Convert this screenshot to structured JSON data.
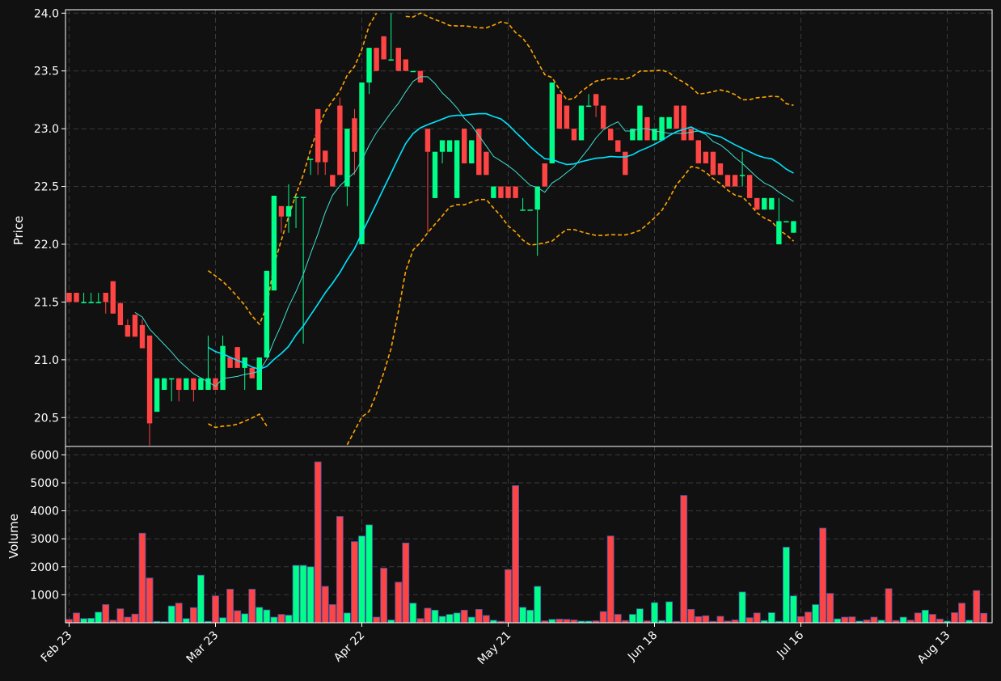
{
  "chart_data": {
    "type": "candlestick",
    "ylabel_price": "Price",
    "ylabel_volume": "Volume",
    "price_ylim": [
      20.25,
      24.03
    ],
    "price_yticks": [
      "20.5",
      "21.0",
      "21.5",
      "22.0",
      "22.5",
      "23.0",
      "23.5",
      "24.0"
    ],
    "volume_ylim": [
      0,
      6300
    ],
    "volume_yticks": [
      "1000",
      "2000",
      "3000",
      "4000",
      "5000",
      "6000"
    ],
    "x_ticks": [
      {
        "label": "Feb 23",
        "index": 0
      },
      {
        "label": "Mar 23",
        "index": 20
      },
      {
        "label": "Apr 22",
        "index": 40
      },
      {
        "label": "May 21",
        "index": 60
      },
      {
        "label": "Jun 18",
        "index": 80
      },
      {
        "label": "Jul 16",
        "index": 100
      },
      {
        "label": "Aug 13",
        "index": 120
      }
    ],
    "grid": true,
    "colors": {
      "background": "#111111",
      "up": "#00ff88",
      "down": "#ff4444",
      "sma_fast": "#40e0d0",
      "sma_slow": "#00e5ff",
      "bands": "#ffa500",
      "volume_edge": "#4455aa"
    },
    "candles": [
      [
        21.58,
        21.58,
        21.5,
        21.5
      ],
      [
        21.58,
        21.58,
        21.5,
        21.5
      ],
      [
        21.5,
        21.58,
        21.5,
        21.5
      ],
      [
        21.5,
        21.58,
        21.5,
        21.5
      ],
      [
        21.5,
        21.58,
        21.5,
        21.5
      ],
      [
        21.58,
        21.58,
        21.4,
        21.5
      ],
      [
        21.68,
        21.68,
        21.4,
        21.4
      ],
      [
        21.49,
        21.5,
        21.3,
        21.3
      ],
      [
        21.3,
        21.35,
        21.2,
        21.2
      ],
      [
        21.39,
        21.39,
        21.2,
        21.2
      ],
      [
        21.3,
        21.35,
        21.1,
        21.1
      ],
      [
        21.21,
        21.21,
        20.26,
        20.45
      ],
      [
        20.55,
        20.84,
        20.55,
        20.84
      ],
      [
        20.74,
        20.84,
        20.74,
        20.84
      ],
      [
        20.84,
        20.84,
        20.64,
        20.84
      ],
      [
        20.84,
        20.84,
        20.64,
        20.74
      ],
      [
        20.74,
        20.84,
        20.74,
        20.84
      ],
      [
        20.84,
        20.84,
        20.64,
        20.74
      ],
      [
        20.74,
        20.84,
        20.74,
        20.84
      ],
      [
        20.74,
        21.21,
        20.74,
        20.84
      ],
      [
        20.84,
        20.84,
        20.74,
        20.74
      ],
      [
        20.74,
        21.21,
        20.74,
        21.12
      ],
      [
        21.02,
        21.02,
        20.93,
        20.93
      ],
      [
        21.11,
        21.11,
        20.93,
        20.93
      ],
      [
        20.93,
        21.02,
        20.74,
        21.02
      ],
      [
        20.93,
        20.93,
        20.84,
        20.84
      ],
      [
        20.74,
        21.02,
        20.74,
        21.02
      ],
      [
        21.02,
        21.77,
        21.02,
        21.77
      ],
      [
        21.6,
        22.42,
        21.6,
        22.42
      ],
      [
        22.33,
        22.33,
        22.1,
        22.24
      ],
      [
        22.24,
        22.52,
        22.1,
        22.33
      ],
      [
        22.41,
        22.41,
        22.14,
        22.41
      ],
      [
        22.41,
        22.41,
        21.14,
        22.41
      ],
      [
        22.74,
        22.74,
        22.6,
        22.74
      ],
      [
        23.17,
        23.17,
        22.6,
        22.71
      ],
      [
        22.81,
        22.81,
        22.6,
        22.71
      ],
      [
        22.6,
        22.6,
        22.5,
        22.5
      ],
      [
        23.2,
        23.27,
        22.6,
        22.6
      ],
      [
        22.5,
        23.0,
        22.33,
        23.0
      ],
      [
        23.09,
        23.17,
        22.6,
        22.8
      ],
      [
        22.0,
        23.4,
        22.0,
        23.4
      ],
      [
        23.4,
        23.7,
        23.3,
        23.7
      ],
      [
        23.7,
        23.7,
        23.5,
        23.5
      ],
      [
        23.8,
        23.8,
        23.6,
        23.6
      ],
      [
        23.6,
        24.0,
        23.6,
        23.6
      ],
      [
        23.7,
        23.7,
        23.5,
        23.5
      ],
      [
        23.6,
        23.6,
        23.5,
        23.5
      ],
      [
        23.5,
        23.5,
        23.5,
        23.5
      ],
      [
        23.5,
        23.5,
        23.4,
        23.4
      ],
      [
        23.0,
        23.0,
        22.1,
        22.8
      ],
      [
        22.4,
        22.8,
        22.4,
        22.8
      ],
      [
        22.8,
        22.9,
        22.7,
        22.9
      ],
      [
        22.8,
        22.9,
        22.8,
        22.9
      ],
      [
        22.4,
        22.9,
        22.4,
        22.9
      ],
      [
        23.0,
        23.0,
        22.7,
        22.7
      ],
      [
        22.7,
        22.9,
        22.7,
        22.9
      ],
      [
        23.0,
        23.0,
        22.6,
        22.6
      ],
      [
        22.8,
        22.8,
        22.6,
        22.6
      ],
      [
        22.4,
        22.5,
        22.4,
        22.5
      ],
      [
        22.5,
        22.5,
        22.4,
        22.4
      ],
      [
        22.5,
        22.5,
        22.4,
        22.4
      ],
      [
        22.5,
        22.5,
        22.4,
        22.4
      ],
      [
        22.3,
        22.4,
        22.3,
        22.3
      ],
      [
        22.3,
        22.3,
        22.3,
        22.3
      ],
      [
        22.3,
        22.5,
        21.9,
        22.5
      ],
      [
        22.7,
        22.7,
        22.5,
        22.5
      ],
      [
        22.7,
        23.4,
        22.7,
        23.4
      ],
      [
        23.3,
        23.3,
        23.0,
        23.0
      ],
      [
        23.2,
        23.2,
        23.0,
        23.0
      ],
      [
        23.0,
        23.0,
        22.9,
        22.9
      ],
      [
        22.9,
        23.2,
        22.9,
        23.2
      ],
      [
        23.2,
        23.3,
        23.2,
        23.2
      ],
      [
        23.3,
        23.3,
        23.1,
        23.2
      ],
      [
        23.2,
        23.2,
        23.0,
        23.0
      ],
      [
        23.0,
        23.0,
        22.9,
        22.9
      ],
      [
        22.9,
        22.9,
        22.8,
        22.8
      ],
      [
        22.8,
        22.8,
        22.6,
        22.6
      ],
      [
        22.9,
        23.0,
        22.9,
        23.0
      ],
      [
        22.9,
        23.2,
        22.9,
        23.2
      ],
      [
        23.1,
        23.1,
        22.9,
        22.9
      ],
      [
        22.9,
        23.0,
        22.9,
        23.0
      ],
      [
        22.9,
        23.1,
        22.9,
        23.1
      ],
      [
        23.0,
        23.1,
        23.0,
        23.1
      ],
      [
        23.2,
        23.2,
        23.0,
        23.0
      ],
      [
        23.2,
        23.2,
        22.9,
        22.9
      ],
      [
        23.0,
        23.0,
        22.9,
        22.9
      ],
      [
        22.9,
        22.9,
        22.7,
        22.7
      ],
      [
        22.8,
        22.8,
        22.7,
        22.7
      ],
      [
        22.8,
        22.8,
        22.6,
        22.6
      ],
      [
        22.7,
        22.7,
        22.6,
        22.6
      ],
      [
        22.6,
        22.6,
        22.5,
        22.5
      ],
      [
        22.6,
        22.6,
        22.5,
        22.5
      ],
      [
        22.6,
        22.8,
        22.5,
        22.6
      ],
      [
        22.6,
        22.6,
        22.4,
        22.4
      ],
      [
        22.4,
        22.4,
        22.3,
        22.3
      ],
      [
        22.3,
        22.4,
        22.3,
        22.4
      ],
      [
        22.3,
        22.4,
        22.3,
        22.4
      ],
      [
        22.0,
        22.4,
        22.0,
        22.2
      ],
      [
        22.2,
        22.2,
        22.2,
        22.2
      ],
      [
        22.1,
        22.2,
        22.1,
        22.2
      ]
    ],
    "volume": [
      120,
      350,
      150,
      160,
      380,
      650,
      90,
      500,
      200,
      310,
      3200,
      1600,
      50,
      40,
      600,
      700,
      150,
      540,
      1700,
      50,
      960,
      180,
      1200,
      430,
      320,
      1200,
      550,
      460,
      200,
      300,
      270,
      2050,
      2050,
      2000,
      5750,
      1300,
      650,
      3800,
      350,
      2900,
      3100,
      3500,
      200,
      1950,
      100,
      1450,
      2850,
      700,
      150,
      520,
      450,
      230,
      300,
      350,
      450,
      200,
      480,
      260,
      90,
      50,
      1900,
      4900,
      550,
      450,
      1300,
      70,
      120,
      130,
      120,
      100,
      60,
      60,
      70,
      400,
      3100,
      300,
      80,
      300,
      500,
      70,
      720,
      80,
      750,
      50,
      4550,
      480,
      220,
      250,
      50,
      230,
      60,
      100,
      1100,
      180,
      350,
      80,
      360,
      50,
      2700,
      960,
      220,
      380,
      650,
      3380,
      1050,
      140,
      200,
      210,
      60,
      100,
      200,
      90,
      1220,
      80,
      200,
      90,
      350,
      450,
      300,
      130,
      60,
      360,
      700,
      90,
      1150,
      340,
      340,
      480
    ]
  }
}
